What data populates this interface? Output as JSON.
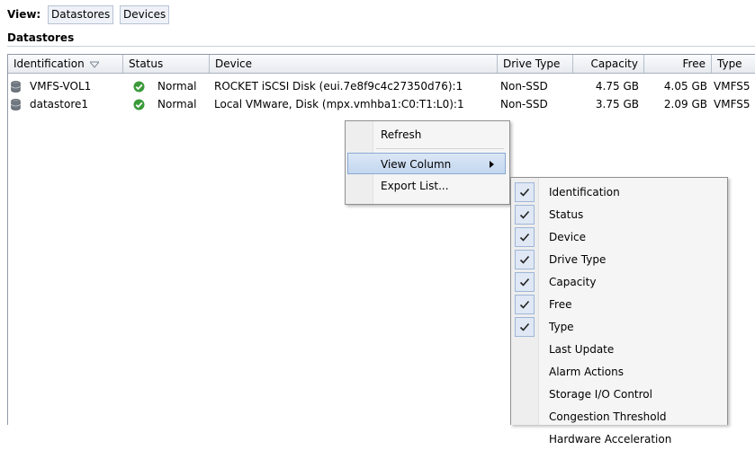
{
  "viewbar": {
    "label": "View:",
    "tabs": [
      "Datastores",
      "Devices"
    ]
  },
  "section_title": "Datastores",
  "table": {
    "headers": [
      "Identification",
      "Status",
      "Device",
      "Drive Type",
      "Capacity",
      "Free",
      "Type"
    ],
    "rows": [
      {
        "identification": "VMFS-VOL1",
        "status": "Normal",
        "device": "ROCKET iSCSI Disk (eui.7e8f9c4c27350d76):1",
        "drive_type": "Non-SSD",
        "capacity": "4.75 GB",
        "free": "4.05 GB",
        "type": "VMFS5"
      },
      {
        "identification": "datastore1",
        "status": "Normal",
        "device": "Local VMware, Disk (mpx.vmhba1:C0:T1:L0):1",
        "drive_type": "Non-SSD",
        "capacity": "3.75 GB",
        "free": "2.09 GB",
        "type": "VMFS5"
      }
    ]
  },
  "context_menu": {
    "items": [
      "Refresh",
      "View Column",
      "Export List..."
    ]
  },
  "submenu": {
    "items": [
      {
        "label": "Identification",
        "checked": true
      },
      {
        "label": "Status",
        "checked": true
      },
      {
        "label": "Device",
        "checked": true
      },
      {
        "label": "Drive Type",
        "checked": true
      },
      {
        "label": "Capacity",
        "checked": true
      },
      {
        "label": "Free",
        "checked": true
      },
      {
        "label": "Type",
        "checked": true
      },
      {
        "label": "Last Update",
        "checked": false
      },
      {
        "label": "Alarm Actions",
        "checked": false
      },
      {
        "label": "Storage I/O Control",
        "checked": false
      },
      {
        "label": "Congestion Threshold",
        "checked": false
      },
      {
        "label": "Hardware Acceleration",
        "checked": false
      }
    ]
  },
  "colors": {
    "status_ok": "#3a9a3a",
    "highlight": "#c3d7ef",
    "check_bg": "#dfe8f4"
  },
  "icons": {
    "datastore": "database-icon",
    "status": "check-circle-icon",
    "sort": "sort-down-icon",
    "submenu": "chevron-right-icon",
    "check": "checkmark-icon"
  }
}
